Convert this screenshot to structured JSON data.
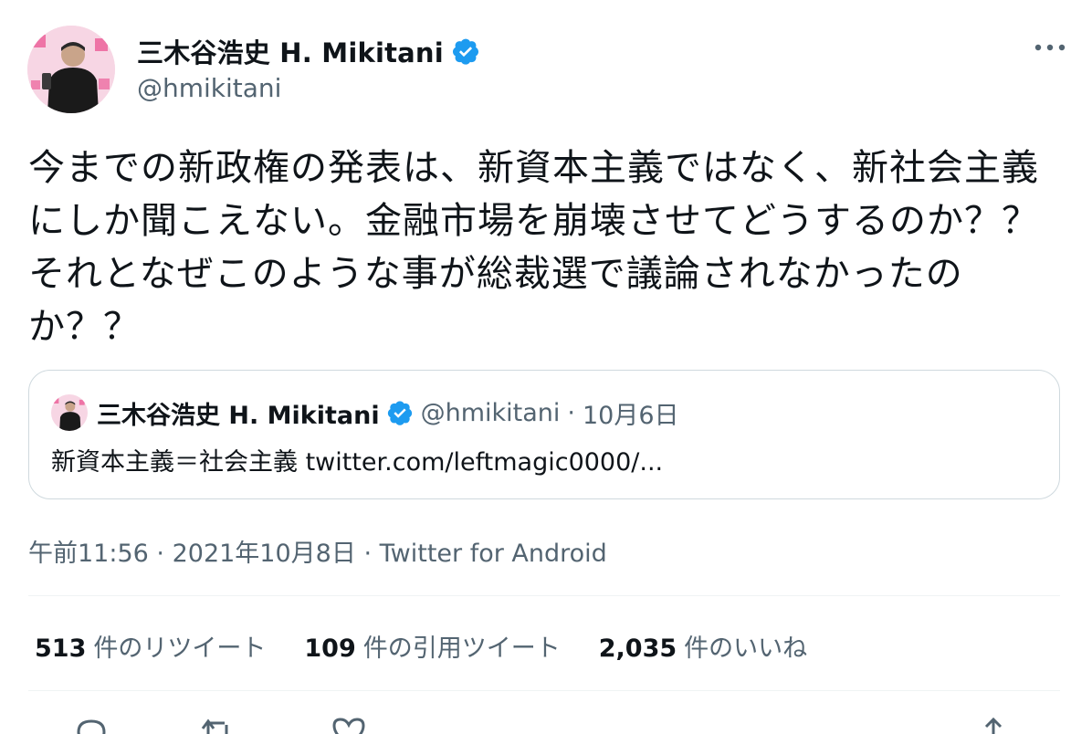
{
  "author": {
    "name": "三木谷浩史 H. Mikitani",
    "handle": "@hmikitani"
  },
  "tweet": {
    "text": "今までの新政権の発表は、新資本主義ではなく、新社会主義にしか聞こえない。金融市場を崩壊させてどうするのか？？それとなぜこのような事が総裁選で議論されなかったのか？？"
  },
  "quoted": {
    "name": "三木谷浩史 H. Mikitani",
    "handle": "@hmikitani",
    "separator": "·",
    "date": "10月6日",
    "text": "新資本主義＝社会主義 twitter.com/leftmagic0000/..."
  },
  "meta": {
    "time": "午前11:56",
    "sep1": "·",
    "date": "2021年10月8日",
    "sep2": "·",
    "source": "Twitter for Android"
  },
  "stats": {
    "retweets_count": "513",
    "retweets_label": "件のリツイート",
    "quotes_count": "109",
    "quotes_label": "件の引用ツイート",
    "likes_count": "2,035",
    "likes_label": "件のいいね"
  },
  "colors": {
    "verified": "#1d9bf0",
    "secondary_text": "#536471",
    "avatar_bg": "#e94a8c"
  },
  "icons": [
    "verified-badge-icon",
    "more-icon",
    "reply-icon",
    "retweet-icon",
    "like-icon",
    "share-icon"
  ]
}
